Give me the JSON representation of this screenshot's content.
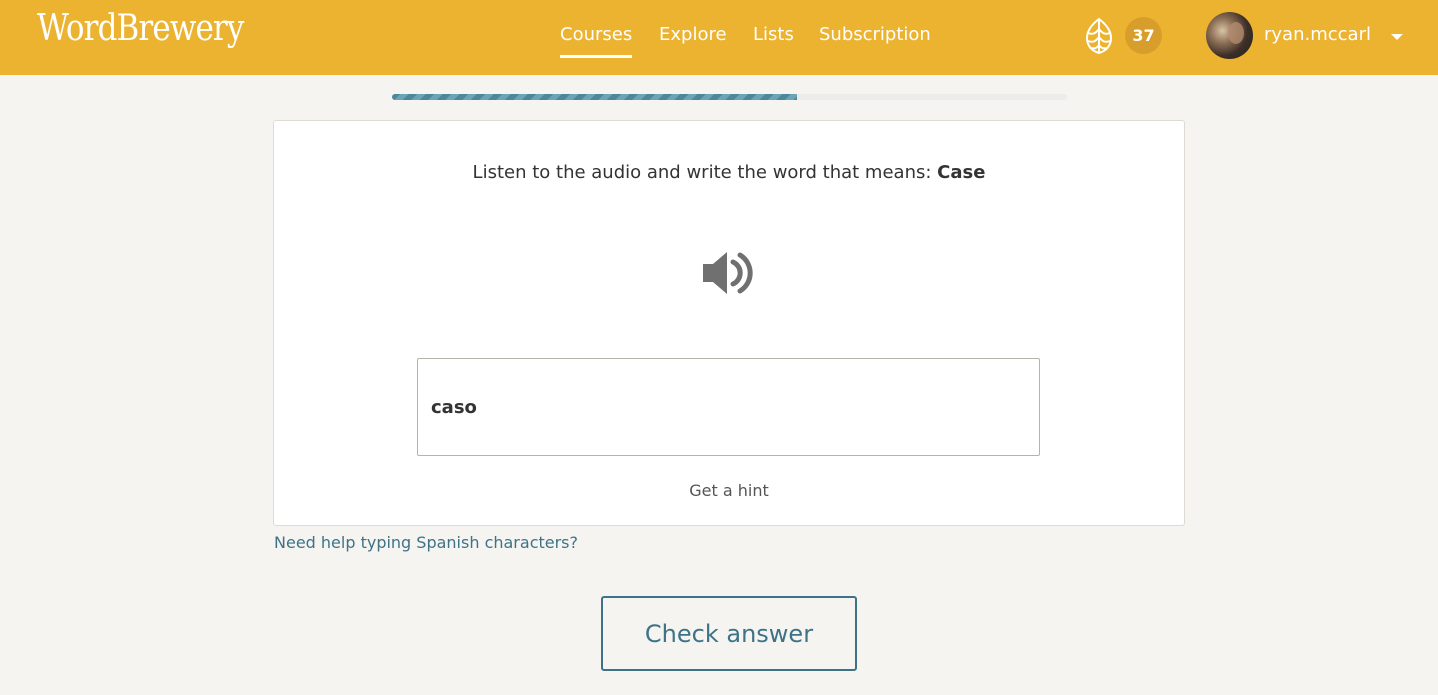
{
  "header": {
    "logo": "WordBrewery",
    "nav": [
      {
        "label": "Courses",
        "active": true
      },
      {
        "label": "Explore",
        "active": false
      },
      {
        "label": "Lists",
        "active": false
      },
      {
        "label": "Subscription",
        "active": false
      }
    ],
    "hops_icon": "hop-icon",
    "hops_count": "37",
    "avatar_icon": "user-avatar",
    "username": "ryan.mccarl",
    "dropdown_icon": "caret-down-icon"
  },
  "progress": {
    "fraction": 0.6
  },
  "exercise": {
    "prompt_text": "Listen to the audio and write the word that means: ",
    "prompt_word": "Case",
    "audio_icon": "speaker-icon",
    "answer_value": "caso",
    "hint_label": "Get a hint"
  },
  "help_link": "Need help typing Spanish characters?",
  "check_label": "Check answer",
  "colors": {
    "header_bg": "#ecb331",
    "accent": "#3e7387",
    "page_bg": "#f5f4f0",
    "badge_bg": "#d79e2c"
  }
}
